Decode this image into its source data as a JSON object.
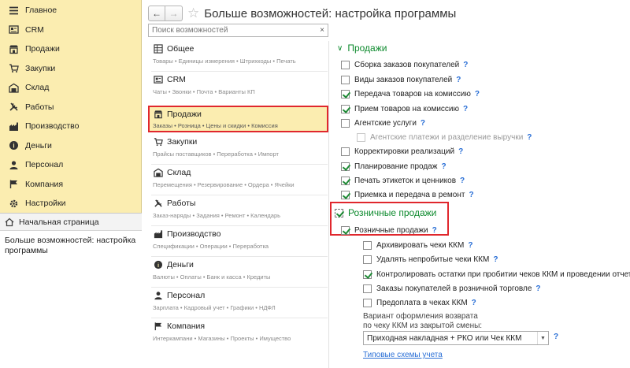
{
  "sidebar": {
    "items": [
      {
        "label": "Главное",
        "icon": "menu-icon"
      },
      {
        "label": "CRM",
        "icon": "crm-icon"
      },
      {
        "label": "Продажи",
        "icon": "shop-icon"
      },
      {
        "label": "Закупки",
        "icon": "cart-icon"
      },
      {
        "label": "Склад",
        "icon": "warehouse-icon"
      },
      {
        "label": "Работы",
        "icon": "tools-icon"
      },
      {
        "label": "Производство",
        "icon": "factory-icon"
      },
      {
        "label": "Деньги",
        "icon": "money-icon"
      },
      {
        "label": "Персонал",
        "icon": "person-icon"
      },
      {
        "label": "Компания",
        "icon": "flag-icon"
      },
      {
        "label": "Настройки",
        "icon": "gear-icon"
      }
    ],
    "open_windows": {
      "home": "Начальная страница",
      "active": "Больше возможностей: настройка программы"
    }
  },
  "header": {
    "back": "←",
    "forward": "→",
    "star": "☆",
    "title": "Больше возможностей: настройка программы"
  },
  "search": {
    "placeholder": "Поиск возможностей",
    "clear": "×"
  },
  "sections": [
    {
      "name": "Общее",
      "sub": "Товары • Единицы измерения • Штрихкоды • Печать"
    },
    {
      "name": "CRM",
      "sub": "Чаты • Звонки • Почта • Варианты КП"
    },
    {
      "name": "Продажи",
      "sub": "Заказы • Розница • Цены и скидки • Комиссия"
    },
    {
      "name": "Закупки",
      "sub": "Прайсы поставщиков • Переработка • Импорт"
    },
    {
      "name": "Склад",
      "sub": "Перемещения • Резервирование • Ордера • Ячейки"
    },
    {
      "name": "Работы",
      "sub": "Заказ-наряды • Задания • Ремонт • Календарь"
    },
    {
      "name": "Производство",
      "sub": "Спецификации • Операции • Переработка"
    },
    {
      "name": "Деньги",
      "sub": "Валюты • Оплаты • Банк и касса • Кредиты"
    },
    {
      "name": "Персонал",
      "sub": "Зарплата • Кадровый учет • Графики • НДФЛ"
    },
    {
      "name": "Компания",
      "sub": "Интеркампани • Магазины • Проекты • Имущество"
    }
  ],
  "right": {
    "group_title": "Продажи",
    "chevron": "∨",
    "help": "?",
    "options": [
      {
        "label": "Сборка заказов покупателей",
        "checked": false
      },
      {
        "label": "Виды заказов покупателей",
        "checked": false
      },
      {
        "label": "Передача товаров на комиссию",
        "checked": true
      },
      {
        "label": "Прием товаров на комиссию",
        "checked": true
      },
      {
        "label": "Агентские услуги",
        "checked": false
      },
      {
        "label": "Агентские платежи и разделение выручки",
        "checked": false,
        "disabled": true
      },
      {
        "label": "Корректировки реализаций",
        "checked": false
      },
      {
        "label": "Планирование продаж",
        "checked": true
      },
      {
        "label": "Печать этикеток и ценников",
        "checked": true
      },
      {
        "label": "Приемка и передача в ремонт",
        "checked": true
      }
    ],
    "retail": {
      "title": "Розничные продажи",
      "checked": true,
      "option": {
        "label": "Розничные продажи",
        "checked": true
      },
      "sub_options": [
        {
          "label": "Архивировать чеки ККМ",
          "checked": false
        },
        {
          "label": "Удалять непробитые чеки ККМ",
          "checked": false
        },
        {
          "label": "Контролировать остатки при пробитии чеков ККМ и проведении отчетов",
          "checked": true
        },
        {
          "label": "Заказы покупателей в розничной торговле",
          "checked": false
        },
        {
          "label": "Предоплата в чеках ККМ",
          "checked": false
        }
      ],
      "variant_label_1": "Вариант оформления возврата",
      "variant_label_2": "по чеку ККМ из закрытой смены:",
      "variant_value": "Приходная накладная + РКО или Чек ККМ",
      "link": "Типовые схемы учета"
    }
  },
  "colors": {
    "sidebar_bg": "#fbedb0",
    "accent_green": "#0d8a2d",
    "highlight_red": "#e0272d",
    "link_blue": "#2a6fd6"
  }
}
